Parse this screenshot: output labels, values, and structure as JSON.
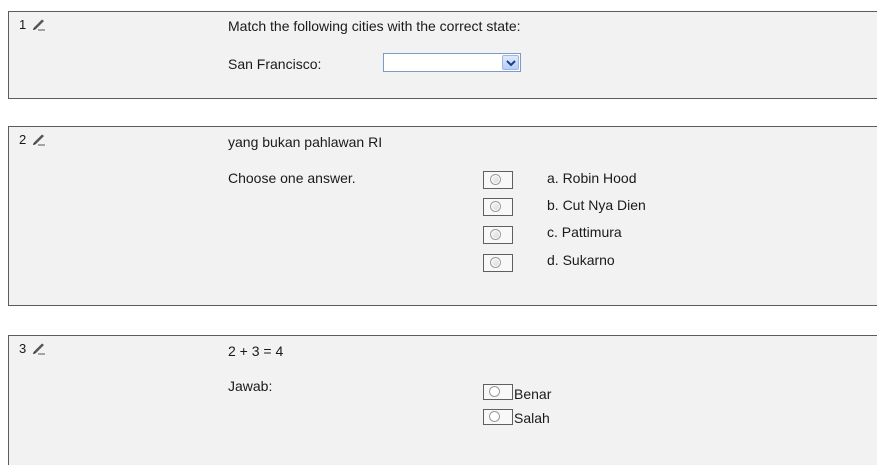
{
  "questions": [
    {
      "number": "1",
      "text": "Match the following cities with the correct state:",
      "sub_label": "San Francisco:",
      "select_value": ""
    },
    {
      "number": "2",
      "text": "yang bukan pahlawan RI",
      "prompt": "Choose one answer.",
      "options": [
        "a. Robin Hood",
        "b. Cut Nya Dien",
        "c. Pattimura",
        "d. Sukarno"
      ]
    },
    {
      "number": "3",
      "text": "2 + 3 = 4",
      "prompt": "Jawab:",
      "options": [
        "Benar",
        "Salah"
      ]
    }
  ],
  "icons": {
    "edit": "edit-pencil-icon"
  }
}
